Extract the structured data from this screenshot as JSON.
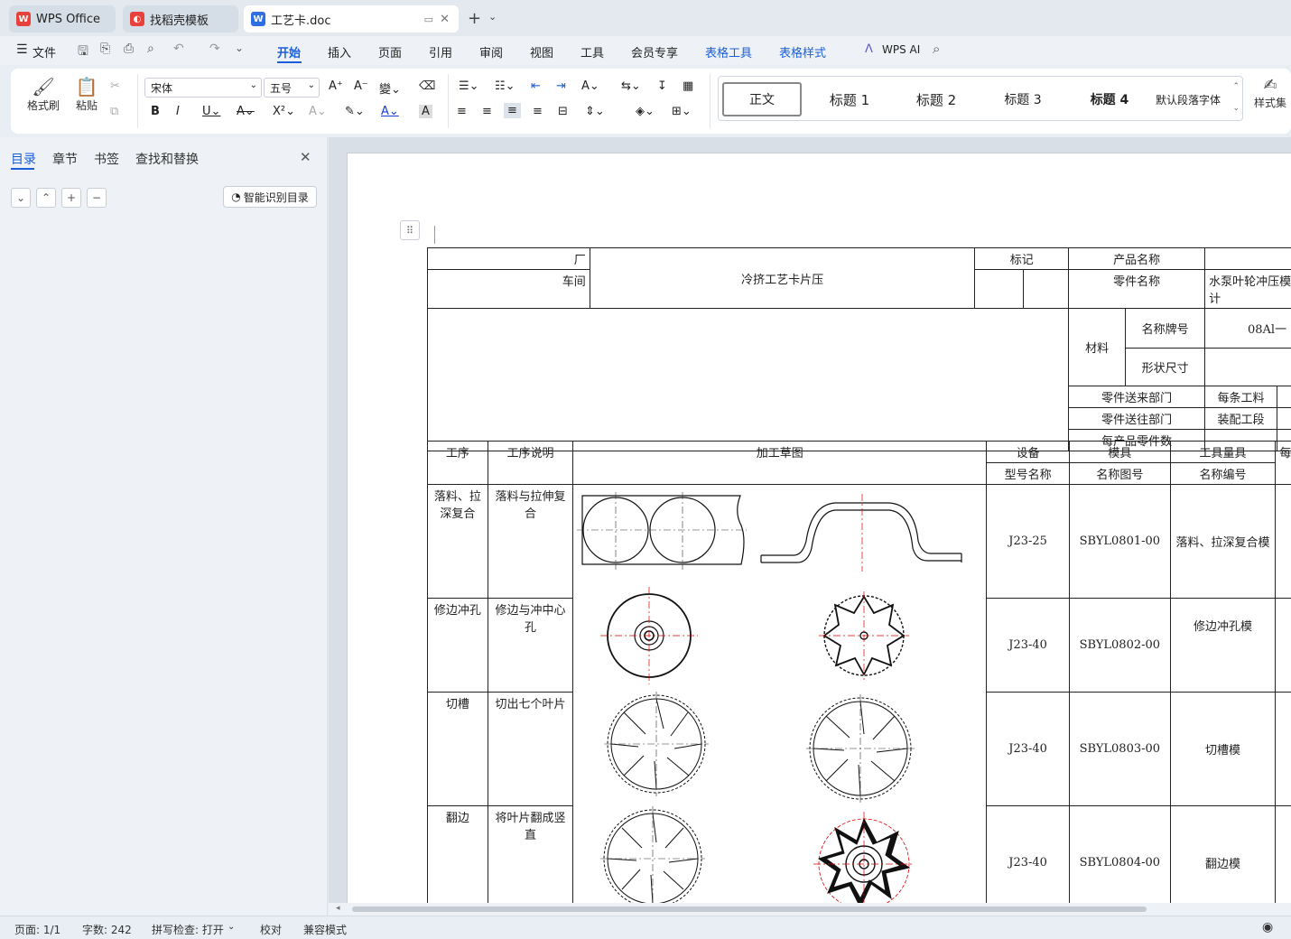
{
  "tabs": [
    {
      "label": "WPS Office"
    },
    {
      "label": "找稻壳模板"
    },
    {
      "label": "工艺卡.doc"
    }
  ],
  "menu": {
    "items": [
      "文件",
      "开始",
      "插入",
      "页面",
      "引用",
      "审阅",
      "视图",
      "工具",
      "会员专享",
      "表格工具",
      "表格样式",
      "WPS AI"
    ]
  },
  "ribbon": {
    "format_painter": "格式刷",
    "paste": "粘贴",
    "font_name": "宋体",
    "font_size": "五号",
    "styles": [
      "正文",
      "标题 1",
      "标题 2",
      "标题 3",
      "标题 4",
      "默认段落字体"
    ],
    "style_set": "样式集"
  },
  "panel": {
    "tabs": [
      "目录",
      "章节",
      "书签",
      "查找和替换"
    ],
    "smart_toc": "智能识别目录"
  },
  "card": {
    "factory": "厂",
    "workshop": "车间",
    "card_title": "冷挤工艺卡片压",
    "mark": "标记",
    "product_name": "产品名称",
    "part_name": "零件名称",
    "part_name_value": "水泵叶轮冲压模具设计",
    "material": "材料",
    "name_grade": "名称牌号",
    "material_value": "08Al一",
    "shape_size": "形状尺寸",
    "from_dept": "零件送来部门",
    "per_strip": "每条工料",
    "to_dept": "零件送往部门",
    "assembly": "装配工段",
    "per_product": "每产品零件数",
    "col_process": "工序",
    "col_desc": "工序说明",
    "col_sketch": "加工草图",
    "col_equip": "设备",
    "col_equip_sub": "型号名称",
    "col_die": "模具",
    "col_die_sub": "名称图号",
    "col_gauge": "工具量具",
    "col_gauge_sub": "名称编号",
    "col_extra": "每",
    "rows": [
      {
        "process": "落料、拉深复合",
        "desc": "落料与拉伸复合",
        "equip": "J23-25",
        "die": "SBYL0801-00",
        "gauge": "落料、拉深复合模"
      },
      {
        "process": "修边冲孔",
        "desc": "修边与冲中心孔",
        "equip": "J23-40",
        "die": "SBYL0802-00",
        "gauge": "修边冲孔模"
      },
      {
        "process": "切槽",
        "desc": "切出七个叶片",
        "equip": "J23-40",
        "die": "SBYL0803-00",
        "gauge": "切槽模"
      },
      {
        "process": "翻边",
        "desc": "将叶片翻成竖直",
        "equip": "J23-40",
        "die": "SBYL0804-00",
        "gauge": "翻边模"
      }
    ]
  },
  "status": {
    "page": "页面: 1/1",
    "words": "字数: 242",
    "spell": "拼写检查: 打开",
    "proof": "校对",
    "compat": "兼容模式"
  },
  "colors": {
    "accent": "#1a5fd8",
    "wps_red": "#e8403a"
  }
}
